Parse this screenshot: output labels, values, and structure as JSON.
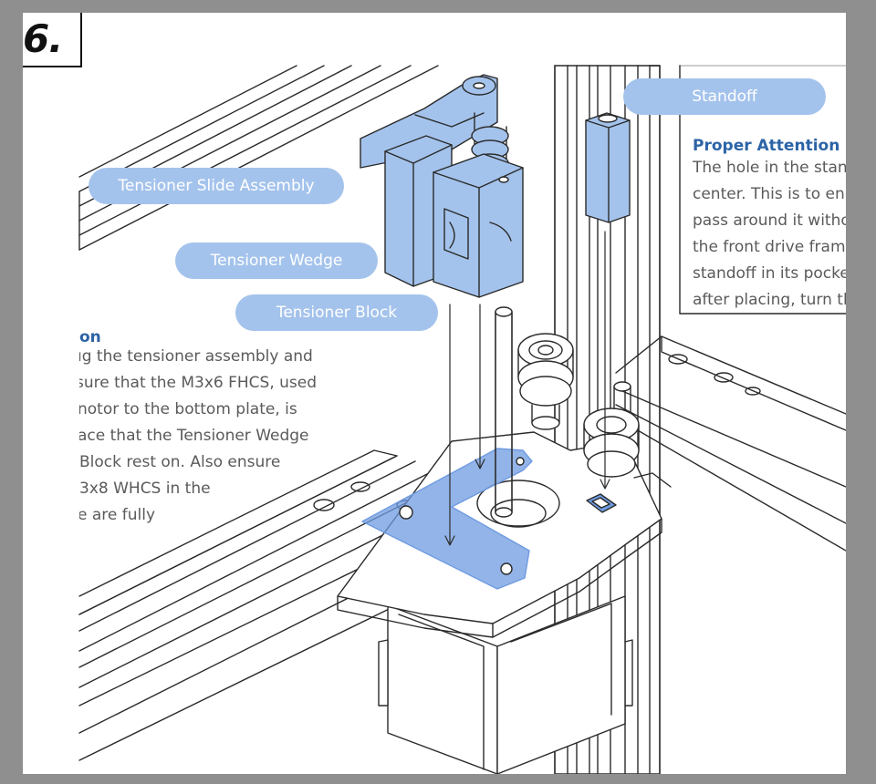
{
  "step": {
    "label": "6."
  },
  "callouts": {
    "tensioner_slide_assembly": "Tensioner Slide Assembly",
    "tensioner_wedge": "Tensioner Wedge",
    "tensioner_block": "Tensioner Block",
    "standoff": "Standoff"
  },
  "right_note": {
    "title": "Proper Attention",
    "lines": [
      "The hole in the stan",
      "center. This is to en",
      "pass around it witho",
      "the front drive fram",
      "standoff in its pocke",
      "after placing, turn th"
    ]
  },
  "left_note": {
    "title": "on",
    "lines": [
      "ıg the tensioner assembly and",
      " sure that the M3x6 FHCS, used",
      "notor to the bottom plate, is",
      "ace that the Tensioner Wedge",
      "Block rest on. Also ensure",
      "3x8 WHCS in the",
      "e are fully"
    ]
  },
  "colors": {
    "highlight": "#a4c3ec",
    "highlight_dark": "#6f9be0",
    "title_blue": "#2c63a6",
    "body_text": "#5a5a5a",
    "frame": "#8f8f8f"
  }
}
